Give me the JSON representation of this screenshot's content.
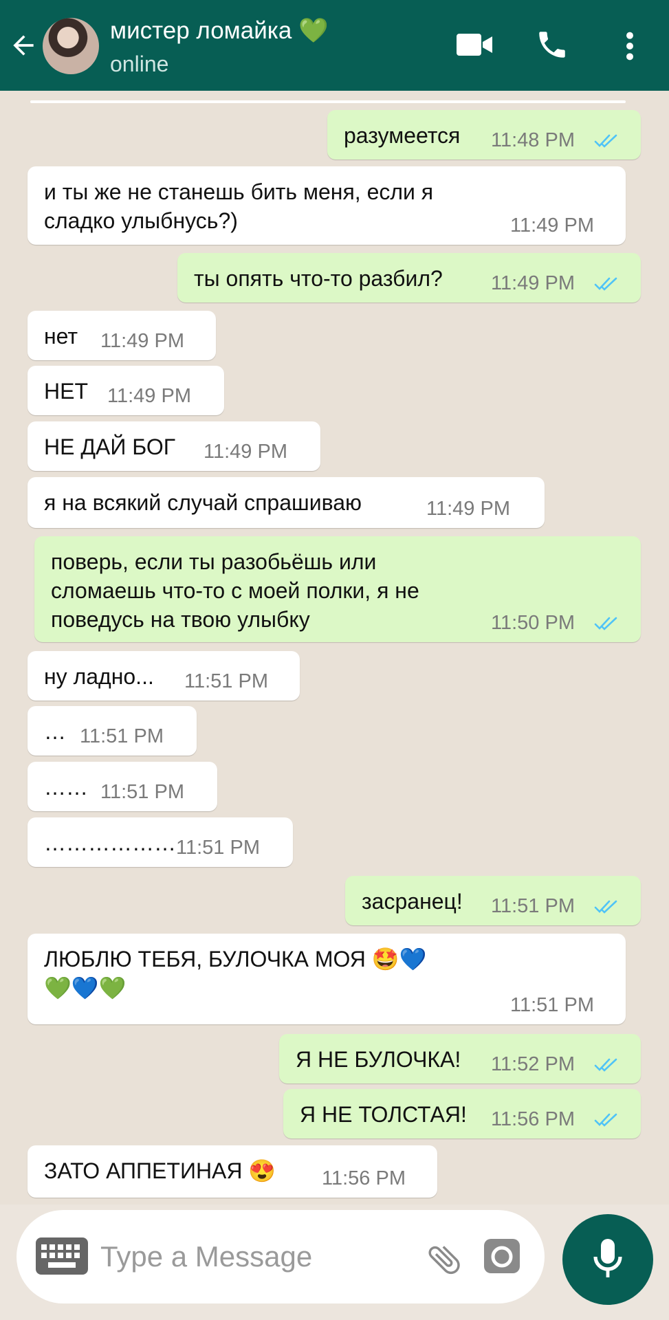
{
  "header": {
    "back_icon": "arrow-left-icon",
    "contact_name": "мистер ломайка 💚",
    "status": "online",
    "icons": [
      "video-call-icon",
      "phone-icon",
      "more-vert-icon"
    ],
    "color": "#075e54"
  },
  "messages": [
    {
      "dir": "out",
      "text": "разумеется",
      "time": "11:48 PM",
      "read": true
    },
    {
      "dir": "in",
      "text": "и ты же не станешь бить меня, если я\nсладко улыбнусь?)",
      "time": "11:49 PM"
    },
    {
      "dir": "out",
      "text": "ты опять что-то разбил?",
      "time": "11:49 PM",
      "read": true
    },
    {
      "dir": "in",
      "text": "нет",
      "time": "11:49 PM"
    },
    {
      "dir": "in",
      "text": "НЕТ",
      "time": "11:49 PM"
    },
    {
      "dir": "in",
      "text": "НЕ ДАЙ БОГ",
      "time": "11:49 PM"
    },
    {
      "dir": "in",
      "text": "я на всякий случай спрашиваю",
      "time": "11:49 PM"
    },
    {
      "dir": "out",
      "text": "поверь, если ты разобьёшь или\nсломаешь что-то с моей полки, я не\nповедусь на твою улыбку",
      "time": "11:50 PM",
      "read": true
    },
    {
      "dir": "in",
      "text": "ну ладно...",
      "time": "11:51 PM"
    },
    {
      "dir": "in",
      "text": "…",
      "time": "11:51 PM"
    },
    {
      "dir": "in",
      "text": "……",
      "time": "11:51 PM"
    },
    {
      "dir": "in",
      "text": "………………",
      "time": "11:51 PM"
    },
    {
      "dir": "out",
      "text": "засранец!",
      "time": "11:51 PM",
      "read": true
    },
    {
      "dir": "in",
      "text": "ЛЮБЛЮ ТЕБЯ, БУЛОЧКА МОЯ 🤩💙\n💚💙💚",
      "time": "11:51 PM"
    },
    {
      "dir": "out",
      "text": "Я НЕ БУЛОЧКА!",
      "time": "11:52 PM",
      "read": true
    },
    {
      "dir": "out",
      "text": "Я НЕ ТОЛСТАЯ!",
      "time": "11:56 PM",
      "read": true
    },
    {
      "dir": "in",
      "text": "ЗАТО АППЕТИНАЯ 😍",
      "time": "11:56 PM"
    }
  ],
  "composer": {
    "placeholder": "Type a Message",
    "icons": [
      "keyboard-icon",
      "attach-icon",
      "camera-icon",
      "mic-icon"
    ]
  },
  "colors": {
    "outgoing_bubble": "#dcf8c6",
    "incoming_bubble": "#ffffff",
    "read_ticks": "#4fc3f7",
    "chat_background": "#e9e1d7"
  }
}
